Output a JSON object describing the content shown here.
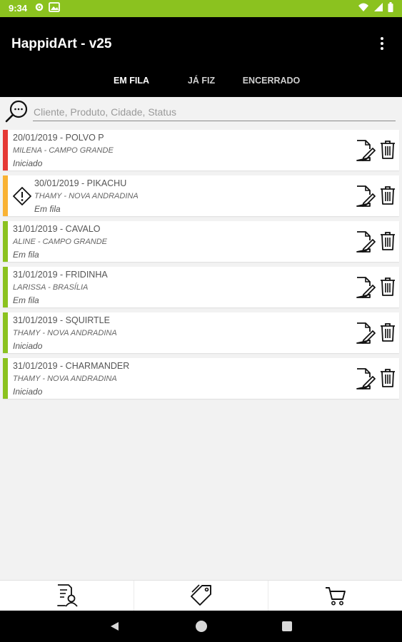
{
  "status_bar": {
    "time": "9:34",
    "background_color": "#8bc21f",
    "left_icons": [
      "gear-icon",
      "image-icon"
    ],
    "right_icons": [
      "wifi-icon",
      "signal-icon",
      "battery-icon"
    ]
  },
  "app_bar": {
    "title": "HappidArt - v25",
    "menu_icon": "more-vert-icon"
  },
  "tabs": [
    {
      "label": "EM FILA",
      "active": true
    },
    {
      "label": "JÁ FIZ",
      "active": false
    },
    {
      "label": "ENCERRADO",
      "active": false
    }
  ],
  "search": {
    "placeholder": "Cliente, Produto, Cidade, Status",
    "value": ""
  },
  "orders": [
    {
      "title": "20/01/2019 - POLVO P",
      "subtitle": "MILENA - CAMPO GRANDE",
      "status": "Iniciado",
      "color": "#e53935",
      "warning": false
    },
    {
      "title": "30/01/2019 - PIKACHU",
      "subtitle": "THAMY - NOVA ANDRADINA",
      "status": "Em fila",
      "color": "#f9b233",
      "warning": true
    },
    {
      "title": "31/01/2019 - CAVALO",
      "subtitle": "ALINE - CAMPO GRANDE",
      "status": "Em fila",
      "color": "#8bc21f",
      "warning": false
    },
    {
      "title": "31/01/2019 - FRIDINHA",
      "subtitle": "LARISSA - BRASÍLIA",
      "status": "Em fila",
      "color": "#8bc21f",
      "warning": false
    },
    {
      "title": "31/01/2019 - SQUIRTLE",
      "subtitle": "THAMY - NOVA ANDRADINA",
      "status": "Iniciado",
      "color": "#8bc21f",
      "warning": false
    },
    {
      "title": "31/01/2019 - CHARMANDER",
      "subtitle": "THAMY - NOVA ANDRADINA",
      "status": "Iniciado",
      "color": "#8bc21f",
      "warning": false
    }
  ],
  "bottom_nav": [
    {
      "icon": "client-list-icon"
    },
    {
      "icon": "tag-icon"
    },
    {
      "icon": "cart-icon"
    }
  ],
  "system_nav": [
    "back-icon",
    "home-icon",
    "recents-icon"
  ]
}
